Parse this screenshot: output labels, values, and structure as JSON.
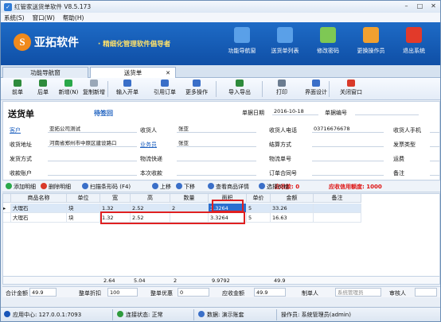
{
  "app": {
    "title": "红管家送货单软件 V8.5.173",
    "menu": [
      "系统(S)",
      "窗口(W)",
      "帮助(H)"
    ]
  },
  "banner": {
    "logo_letter": "S",
    "brand": "亚拓软件",
    "slogan": "· 精细化管理软件倡导者",
    "buttons": [
      {
        "label": "功能导航窗",
        "icon": "monitor-icon",
        "color": "#5aa0e8"
      },
      {
        "label": "送货单列表",
        "icon": "list-icon",
        "color": "#5aa0e8"
      },
      {
        "label": "修改密码",
        "icon": "lock-icon",
        "color": "#7ec854"
      },
      {
        "label": "更换操作员",
        "icon": "user-icon",
        "color": "#f0a030"
      },
      {
        "label": "退出系统",
        "icon": "power-icon",
        "color": "#e23a2a"
      }
    ]
  },
  "tabs": [
    {
      "label": "功能导航窗"
    },
    {
      "label": "送货单"
    }
  ],
  "toolbar": [
    {
      "label": "前单",
      "icon": "arrow-left-icon",
      "color": "#2e8b3c"
    },
    {
      "label": "后单",
      "icon": "arrow-right-icon",
      "color": "#2e8b3c"
    },
    {
      "label": "新增(N)",
      "icon": "plus-icon",
      "color": "#2aa84a"
    },
    {
      "label": "复制新增",
      "icon": "copy-icon",
      "color": "#9aa8b8"
    },
    {
      "label": "输入开单",
      "icon": "save-icon",
      "color": "#3a6fc8"
    },
    {
      "label": "引用订单",
      "icon": "import-icon",
      "color": "#3a6fc8"
    },
    {
      "label": "更多操作",
      "icon": "more-icon",
      "color": "#3a6fc8"
    },
    {
      "label": "导入导出",
      "icon": "export-icon",
      "color": "#2e8b3c"
    },
    {
      "label": "打印",
      "icon": "print-icon",
      "color": "#6b7c90"
    },
    {
      "label": "界面设计",
      "icon": "design-icon",
      "color": "#3a6fc8"
    },
    {
      "label": "关闭窗口",
      "icon": "close-window-icon",
      "color": "#d93a2a"
    }
  ],
  "form": {
    "title": "送货单",
    "status": "待签回",
    "date_label": "单据日期",
    "date": "2016-10-18",
    "no_label": "单据编号",
    "no": "",
    "fields": [
      {
        "label": "客户",
        "value": "亚拓公司测试",
        "link": true
      },
      {
        "label": "收货人",
        "value": "张亚"
      },
      {
        "label": "收货人电话",
        "value": "03716676678"
      },
      {
        "label": "收货人手机",
        "value": ""
      },
      {
        "label": "收货地址",
        "value": "河南省郑州市中原区建设路口"
      },
      {
        "label": "业务员",
        "value": "张亚",
        "link": true
      },
      {
        "label": "结算方式",
        "value": ""
      },
      {
        "label": "发票类型",
        "value": ""
      },
      {
        "label": "发货方式",
        "value": ""
      },
      {
        "label": "物流快递",
        "value": ""
      },
      {
        "label": "物流单号",
        "value": ""
      },
      {
        "label": "运费",
        "value": ""
      },
      {
        "label": "收款账户",
        "value": ""
      },
      {
        "label": "本次收款",
        "value": ""
      },
      {
        "label": "订单合同号",
        "value": ""
      },
      {
        "label": "备注",
        "value": ""
      }
    ]
  },
  "detail_toolbar": {
    "items": [
      {
        "label": "添加明细",
        "icon": "add-icon",
        "color": "#2aa84a"
      },
      {
        "label": "删除明细",
        "icon": "delete-icon",
        "color": "#d93a2a"
      },
      {
        "label": "扫描条形码 (F4)",
        "icon": "barcode-icon",
        "color": "#3a6fc8"
      },
      {
        "label": "上移",
        "icon": "up-icon",
        "color": "#3a6fc8"
      },
      {
        "label": "下移",
        "icon": "down-icon",
        "color": "#3a6fc8"
      },
      {
        "label": "查看商品详情",
        "icon": "detail-icon",
        "color": "#3a6fc8"
      },
      {
        "label": "选择价格",
        "icon": "price-icon",
        "color": "#3a6fc8"
      }
    ],
    "received": "应收款: 0",
    "credit": "应收信用额度: 1000"
  },
  "grid": {
    "columns": [
      "商品名称",
      "单位",
      "宽",
      "高",
      "数量",
      "面积",
      "单价",
      "金额",
      "备注"
    ],
    "rows": [
      {
        "name": "大理石",
        "unit": "块",
        "w": "1.32",
        "h": "2.52",
        "qty": "2",
        "area": "3.3264",
        "price": "5",
        "amount": "33.26",
        "note": "",
        "selected": true
      },
      {
        "name": "大理石",
        "unit": "块",
        "w": "1.32",
        "h": "2.52",
        "qty": "",
        "area": "3.3264",
        "price": "5",
        "amount": "16.63",
        "note": ""
      }
    ],
    "totals": {
      "w": "2.64",
      "h": "5.04",
      "qty": "2",
      "area": "9.9792",
      "amount": "49.9"
    }
  },
  "footer": [
    {
      "label": "合计金额",
      "value": "49.9"
    },
    {
      "label": "整单折扣",
      "value": "100"
    },
    {
      "label": "整单优惠",
      "value": "0"
    },
    {
      "label": "应收金额",
      "value": "49.9"
    },
    {
      "label": "制单人",
      "value": "系统管理员"
    },
    {
      "label": "审核人",
      "value": ""
    }
  ],
  "statusbar": [
    {
      "label": "应用中心: 127.0.0.1:7093",
      "color": "#1a56b8"
    },
    {
      "label": "连接状态: 正常",
      "color": "#2e9a3c"
    },
    {
      "label": "数据: 演示账套",
      "color": "#3a6fc8"
    },
    {
      "label": "操作员: 系统管理员(admin)"
    }
  ]
}
